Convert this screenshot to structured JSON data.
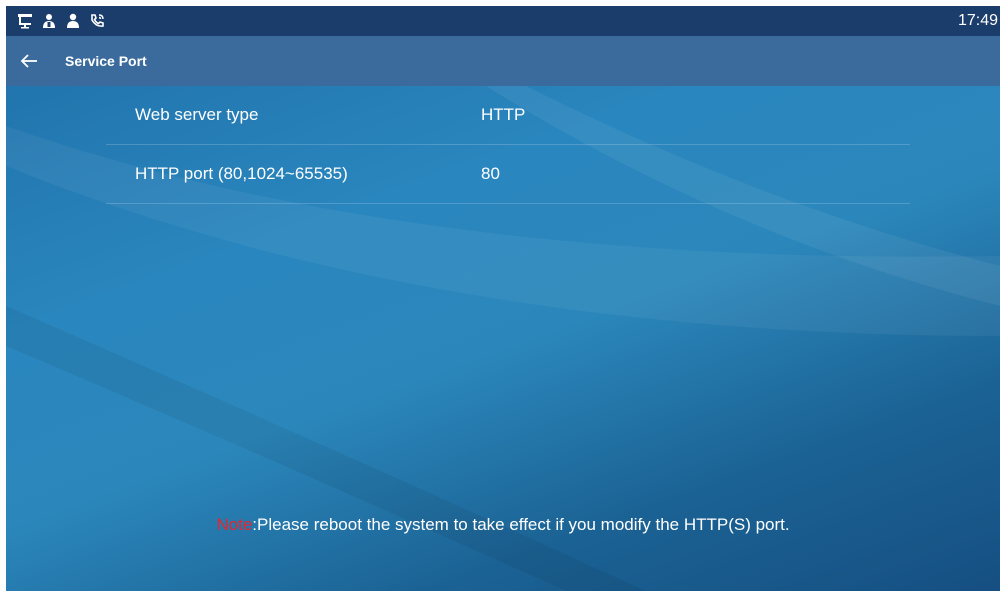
{
  "status_bar": {
    "icons": [
      "network-icon",
      "contacts-icon",
      "user-icon",
      "call-icon"
    ],
    "time": "17:49"
  },
  "header": {
    "title": "Service Port",
    "back_icon": "back-arrow-icon"
  },
  "settings": [
    {
      "label": "Web server type",
      "value": "HTTP"
    },
    {
      "label": "HTTP port (80,1024~65535)",
      "value": "80"
    }
  ],
  "note": {
    "prefix": "Note",
    "message": ":Please reboot the system to take effect if you modify the HTTP(S) port."
  },
  "colors": {
    "status_bar": "#1b3d6b",
    "title_bar": "#3a6b9c",
    "background": "#2a86be",
    "note_prefix": "#e8252e"
  }
}
